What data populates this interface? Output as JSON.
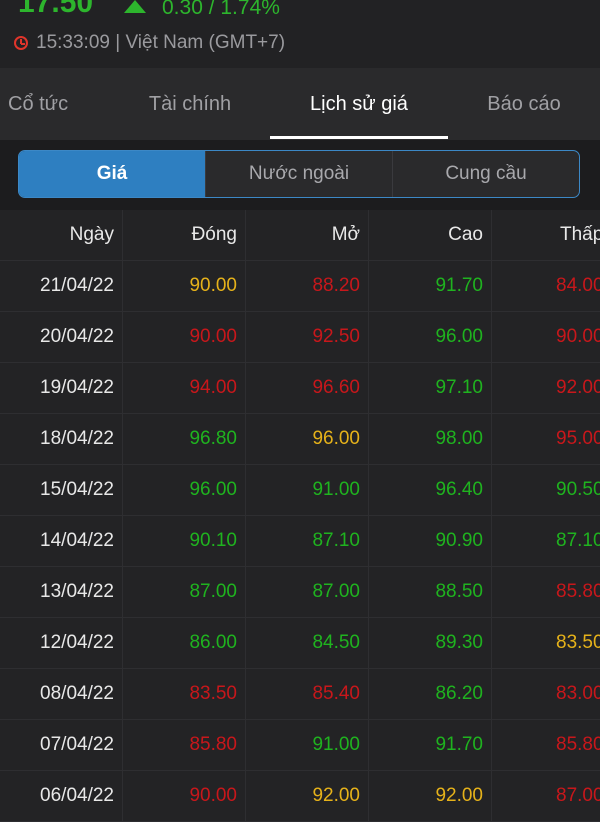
{
  "header": {
    "price": "17.50",
    "change": "0.30 / 1.74%",
    "time": "15:33:09 | Việt Nam (GMT+7)"
  },
  "tabs": [
    "Cổ tức",
    "Tài chính",
    "Lịch sử giá",
    "Báo cáo"
  ],
  "active_tab": "Lịch sử giá",
  "segments": [
    "Giá",
    "Nước ngoài",
    "Cung cầu"
  ],
  "active_segment": "Giá",
  "table": {
    "columns": [
      "Ngày",
      "Đóng",
      "Mở",
      "Cao",
      "Thấp"
    ],
    "rows": [
      {
        "date": "21/04/22",
        "close": "90.00",
        "close_c": "y",
        "open": "88.20",
        "open_c": "r",
        "high": "91.70",
        "high_c": "g",
        "low": "84.00",
        "low_c": "r"
      },
      {
        "date": "20/04/22",
        "close": "90.00",
        "close_c": "r",
        "open": "92.50",
        "open_c": "r",
        "high": "96.00",
        "high_c": "g",
        "low": "90.00",
        "low_c": "r"
      },
      {
        "date": "19/04/22",
        "close": "94.00",
        "close_c": "r",
        "open": "96.60",
        "open_c": "r",
        "high": "97.10",
        "high_c": "g",
        "low": "92.00",
        "low_c": "r"
      },
      {
        "date": "18/04/22",
        "close": "96.80",
        "close_c": "g",
        "open": "96.00",
        "open_c": "y",
        "high": "98.00",
        "high_c": "g",
        "low": "95.00",
        "low_c": "r"
      },
      {
        "date": "15/04/22",
        "close": "96.00",
        "close_c": "g",
        "open": "91.00",
        "open_c": "g",
        "high": "96.40",
        "high_c": "g",
        "low": "90.50",
        "low_c": "g"
      },
      {
        "date": "14/04/22",
        "close": "90.10",
        "close_c": "g",
        "open": "87.10",
        "open_c": "g",
        "high": "90.90",
        "high_c": "g",
        "low": "87.10",
        "low_c": "g"
      },
      {
        "date": "13/04/22",
        "close": "87.00",
        "close_c": "g",
        "open": "87.00",
        "open_c": "g",
        "high": "88.50",
        "high_c": "g",
        "low": "85.80",
        "low_c": "r"
      },
      {
        "date": "12/04/22",
        "close": "86.00",
        "close_c": "g",
        "open": "84.50",
        "open_c": "g",
        "high": "89.30",
        "high_c": "g",
        "low": "83.50",
        "low_c": "y"
      },
      {
        "date": "08/04/22",
        "close": "83.50",
        "close_c": "r",
        "open": "85.40",
        "open_c": "r",
        "high": "86.20",
        "high_c": "g",
        "low": "83.00",
        "low_c": "r"
      },
      {
        "date": "07/04/22",
        "close": "85.80",
        "close_c": "r",
        "open": "91.00",
        "open_c": "g",
        "high": "91.70",
        "high_c": "g",
        "low": "85.80",
        "low_c": "r"
      },
      {
        "date": "06/04/22",
        "close": "90.00",
        "close_c": "r",
        "open": "92.00",
        "open_c": "y",
        "high": "92.00",
        "high_c": "y",
        "low": "87.00",
        "low_c": "r"
      }
    ]
  },
  "colors": {
    "up": "#1fb31f",
    "down": "#c8171b",
    "reference": "#e6b21a",
    "accent": "#2e7fc1"
  },
  "icons": {
    "trend": "up-arrow-icon",
    "time": "clock-icon"
  }
}
